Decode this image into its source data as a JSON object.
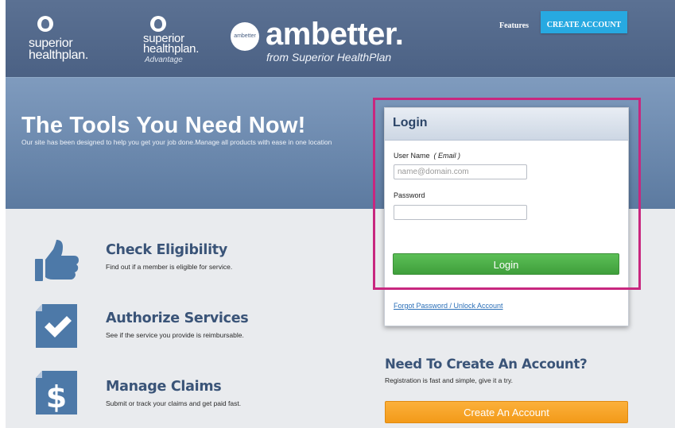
{
  "header": {
    "logo_superior": {
      "line1": "superior",
      "line2": "healthplan."
    },
    "logo_advantage": {
      "line1": "superior",
      "line2": "healthplan.",
      "line3": "Advantage"
    },
    "logo_ambetter": {
      "badge": "ambetter",
      "word": "ambetter.",
      "tagline": "from Superior HealthPlan"
    },
    "nav": {
      "features": "Features",
      "create_account": "CREATE ACCOUNT"
    }
  },
  "hero": {
    "title": "The Tools You Need Now!",
    "subtitle": "Our site has been designed to help you get your job done.Manage all products with ease in one location"
  },
  "features": [
    {
      "icon": "thumbs-up-icon",
      "title": "Check Eligibility",
      "description": "Find out if a member is eligible for service."
    },
    {
      "icon": "checkmark-document-icon",
      "title": "Authorize Services",
      "description": "See if the service you provide is reimbursable."
    },
    {
      "icon": "dollar-document-icon",
      "title": "Manage Claims",
      "description": "Submit or track your claims and get paid fast."
    }
  ],
  "login": {
    "title": "Login",
    "username_label": "User Name",
    "username_hint": "( Email )",
    "username_placeholder": "name@domain.com",
    "password_label": "Password",
    "password_value": "",
    "button": "Login",
    "forgot_link": "Forgot Password / Unlock Account"
  },
  "create": {
    "title": "Need To Create An Account?",
    "subtitle": "Registration is fast and simple, give it a try.",
    "button": "Create An Account"
  },
  "colors": {
    "header_bg": "#4b6184",
    "hero_bg": "#7f9bbe",
    "accent_blue": "#27a9e1",
    "login_green": "#4caf50",
    "create_orange": "#f7a22a",
    "highlight": "#c8277f",
    "heading_blue": "#3a5478"
  }
}
